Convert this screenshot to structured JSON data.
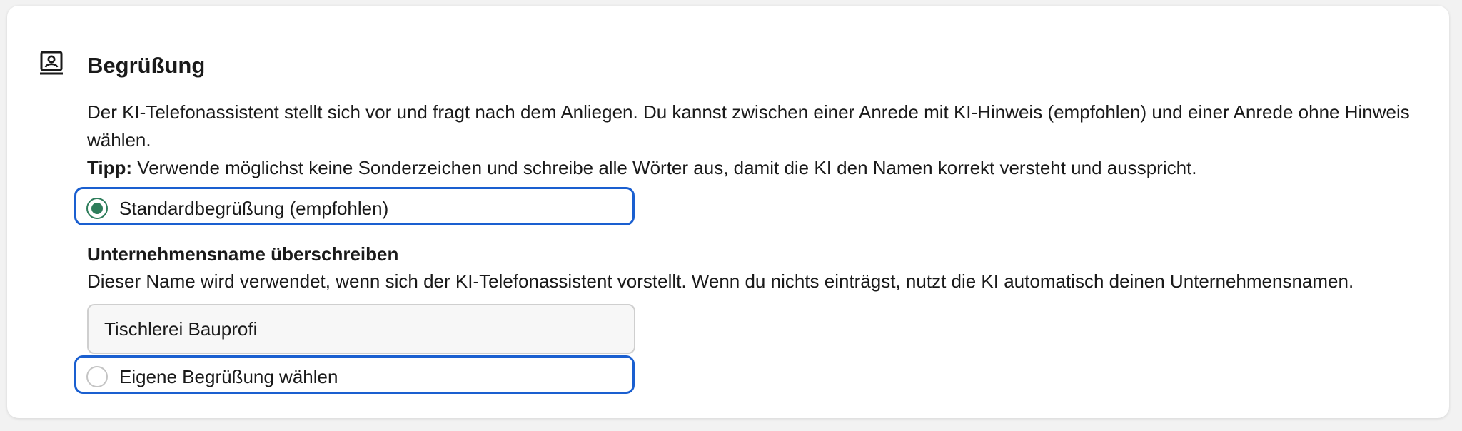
{
  "section": {
    "icon": "contact-card-icon",
    "title": "Begrüßung",
    "description": "Der KI-Telefonassistent stellt sich vor und fragt nach dem Anliegen. Du kannst zwischen einer Anrede mit KI-Hinweis (empfohlen) und einer Anrede ohne Hinweis wählen.",
    "tip_label": "Tipp:",
    "tip_text": " Verwende möglichst keine Sonderzeichen und schreibe alle Wörter aus, damit die KI den Namen korrekt versteht und ausspricht."
  },
  "options": [
    {
      "label": "Standardbegrüßung (empfohlen)",
      "checked": true
    },
    {
      "label": "Eigene Begrüßung wählen",
      "checked": false
    }
  ],
  "company_name": {
    "label": "Unternehmensname überschreiben",
    "help": "Dieser Name wird verwendet, wenn sich der KI-Telefonassistent vorstellt. Wenn du nichts einträgst, nutzt die KI automatisch deinen Unternehmensnamen.",
    "value": "Tischlerei Bauprofi"
  },
  "colors": {
    "accent_border": "#1a5fd0",
    "radio_checked": "#2e7d5b"
  }
}
